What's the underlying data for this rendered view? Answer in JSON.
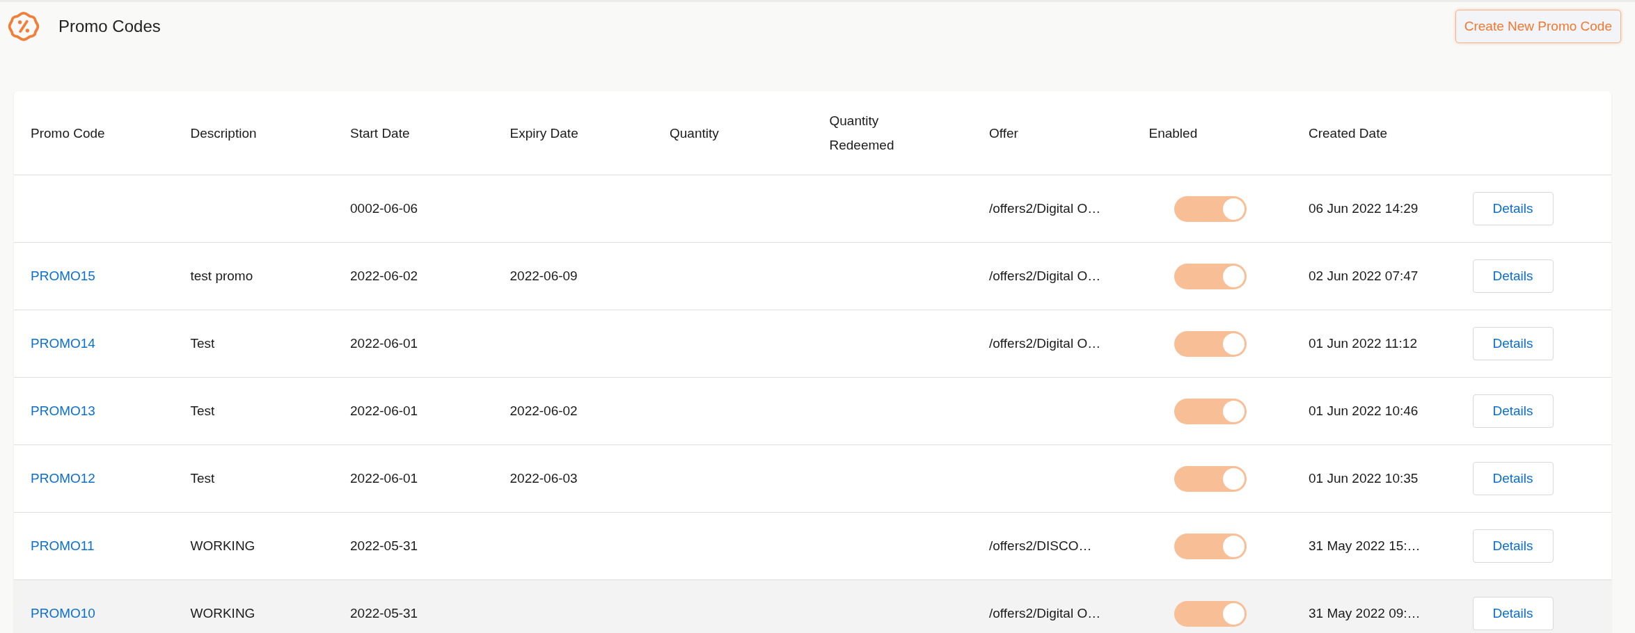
{
  "header": {
    "title": "Promo Codes",
    "create_button": "Create New Promo Code"
  },
  "table": {
    "columns": [
      "Promo Code",
      "Description",
      "Start Date",
      "Expiry Date",
      "Quantity",
      "Quantity Redeemed",
      "Offer",
      "Enabled",
      "Created Date"
    ],
    "rows": [
      {
        "promo_code": "",
        "description": "",
        "start_date": "0002-06-06",
        "expiry_date": "",
        "quantity": "",
        "quantity_redeemed": "",
        "offer": "/offers2/Digital O…",
        "enabled": true,
        "created_date": "06 Jun 2022 14:29",
        "action": "Details",
        "hovered": false
      },
      {
        "promo_code": "PROMO15",
        "description": "test promo",
        "start_date": "2022-06-02",
        "expiry_date": "2022-06-09",
        "quantity": "",
        "quantity_redeemed": "",
        "offer": "/offers2/Digital O…",
        "enabled": true,
        "created_date": "02 Jun 2022 07:47",
        "action": "Details",
        "hovered": false
      },
      {
        "promo_code": "PROMO14",
        "description": "Test",
        "start_date": "2022-06-01",
        "expiry_date": "",
        "quantity": "",
        "quantity_redeemed": "",
        "offer": "/offers2/Digital O…",
        "enabled": true,
        "created_date": "01 Jun 2022 11:12",
        "action": "Details",
        "hovered": false
      },
      {
        "promo_code": "PROMO13",
        "description": "Test",
        "start_date": "2022-06-01",
        "expiry_date": "2022-06-02",
        "quantity": "",
        "quantity_redeemed": "",
        "offer": "",
        "enabled": true,
        "created_date": "01 Jun 2022 10:46",
        "action": "Details",
        "hovered": false
      },
      {
        "promo_code": "PROMO12",
        "description": "Test",
        "start_date": "2022-06-01",
        "expiry_date": "2022-06-03",
        "quantity": "",
        "quantity_redeemed": "",
        "offer": "",
        "enabled": true,
        "created_date": "01 Jun 2022 10:35",
        "action": "Details",
        "hovered": false
      },
      {
        "promo_code": "PROMO11",
        "description": "WORKING",
        "start_date": "2022-05-31",
        "expiry_date": "",
        "quantity": "",
        "quantity_redeemed": "",
        "offer": "/offers2/DISCO…",
        "enabled": true,
        "created_date": "31 May 2022 15:…",
        "action": "Details",
        "hovered": false
      },
      {
        "promo_code": "PROMO10",
        "description": "WORKING",
        "start_date": "2022-05-31",
        "expiry_date": "",
        "quantity": "",
        "quantity_redeemed": "",
        "offer": "/offers2/Digital O…",
        "enabled": true,
        "created_date": "31 May 2022 09:…",
        "action": "Details",
        "hovered": true
      }
    ]
  }
}
